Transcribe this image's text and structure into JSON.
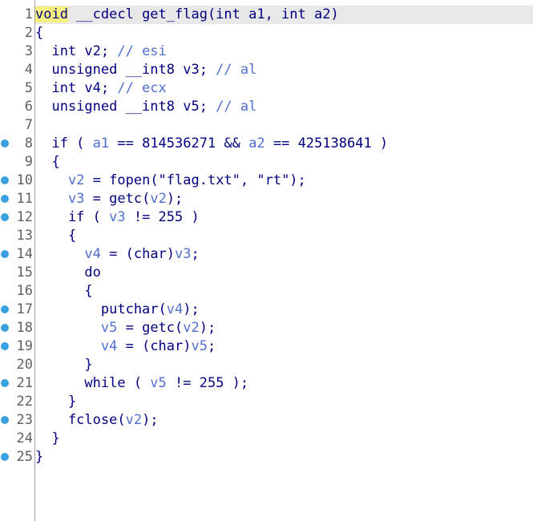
{
  "colors": {
    "background": "#ffffff",
    "keyword": "#000080",
    "variable": "#4f6fd0",
    "line_number": "#606060",
    "breakpoint": "#3aa0e0",
    "highlight_line": "#e8e8e8",
    "highlight_token": "#f5f080",
    "gutter_divider": "#a0a0a0"
  },
  "lines": [
    {
      "num": "1",
      "bp": false,
      "hl": true,
      "tokens": [
        {
          "t": "void",
          "c": "hl"
        },
        {
          "t": " __cdecl get_flag(int a1, int a2)",
          "c": "plain"
        }
      ]
    },
    {
      "num": "2",
      "bp": false,
      "tokens": [
        {
          "t": "{",
          "c": "plain"
        }
      ]
    },
    {
      "num": "3",
      "bp": false,
      "tokens": [
        {
          "t": "  int v2; // esi",
          "c": "mixcmt",
          "split": [
            "  int v2; ",
            "// esi"
          ]
        }
      ]
    },
    {
      "num": "4",
      "bp": false,
      "tokens": [
        {
          "t": "  unsigned __int8 v3; // al",
          "c": "mixcmt",
          "split": [
            "  unsigned __int8 v3; ",
            "// al"
          ]
        }
      ]
    },
    {
      "num": "5",
      "bp": false,
      "tokens": [
        {
          "t": "  int v4; // ecx",
          "c": "mixcmt",
          "split": [
            "  int v4; ",
            "// ecx"
          ]
        }
      ]
    },
    {
      "num": "6",
      "bp": false,
      "tokens": [
        {
          "t": "  unsigned __int8 v5; // al",
          "c": "mixcmt",
          "split": [
            "  unsigned __int8 v5; ",
            "// al"
          ]
        }
      ]
    },
    {
      "num": "7",
      "bp": false,
      "tokens": []
    },
    {
      "num": "8",
      "bp": true,
      "tokens": [
        {
          "t": "  if ( ",
          "c": "plain"
        },
        {
          "t": "a1",
          "c": "var"
        },
        {
          "t": " == 814536271 && ",
          "c": "plain"
        },
        {
          "t": "a2",
          "c": "var"
        },
        {
          "t": " == 425138641 )",
          "c": "plain"
        }
      ]
    },
    {
      "num": "9",
      "bp": false,
      "tokens": [
        {
          "t": "  {",
          "c": "plain"
        }
      ]
    },
    {
      "num": "10",
      "bp": true,
      "tokens": [
        {
          "t": "    ",
          "c": "plain"
        },
        {
          "t": "v2",
          "c": "var"
        },
        {
          "t": " = fopen(\"flag.txt\", \"rt\");",
          "c": "plain"
        }
      ]
    },
    {
      "num": "11",
      "bp": true,
      "tokens": [
        {
          "t": "    ",
          "c": "plain"
        },
        {
          "t": "v3",
          "c": "var"
        },
        {
          "t": " = getc(",
          "c": "plain"
        },
        {
          "t": "v2",
          "c": "var"
        },
        {
          "t": ");",
          "c": "plain"
        }
      ]
    },
    {
      "num": "12",
      "bp": true,
      "tokens": [
        {
          "t": "    if ( ",
          "c": "plain"
        },
        {
          "t": "v3",
          "c": "var"
        },
        {
          "t": " != 255 )",
          "c": "plain"
        }
      ]
    },
    {
      "num": "13",
      "bp": false,
      "tokens": [
        {
          "t": "    {",
          "c": "plain"
        }
      ]
    },
    {
      "num": "14",
      "bp": true,
      "tokens": [
        {
          "t": "      ",
          "c": "plain"
        },
        {
          "t": "v4",
          "c": "var"
        },
        {
          "t": " = (char)",
          "c": "plain"
        },
        {
          "t": "v3",
          "c": "var"
        },
        {
          "t": ";",
          "c": "plain"
        }
      ]
    },
    {
      "num": "15",
      "bp": false,
      "tokens": [
        {
          "t": "      do",
          "c": "plain"
        }
      ]
    },
    {
      "num": "16",
      "bp": false,
      "tokens": [
        {
          "t": "      {",
          "c": "plain"
        }
      ]
    },
    {
      "num": "17",
      "bp": true,
      "tokens": [
        {
          "t": "        putchar(",
          "c": "plain"
        },
        {
          "t": "v4",
          "c": "var"
        },
        {
          "t": ");",
          "c": "plain"
        }
      ]
    },
    {
      "num": "18",
      "bp": true,
      "tokens": [
        {
          "t": "        ",
          "c": "plain"
        },
        {
          "t": "v5",
          "c": "var"
        },
        {
          "t": " = getc(",
          "c": "plain"
        },
        {
          "t": "v2",
          "c": "var"
        },
        {
          "t": ");",
          "c": "plain"
        }
      ]
    },
    {
      "num": "19",
      "bp": true,
      "tokens": [
        {
          "t": "        ",
          "c": "plain"
        },
        {
          "t": "v4",
          "c": "var"
        },
        {
          "t": " = (char)",
          "c": "plain"
        },
        {
          "t": "v5",
          "c": "var"
        },
        {
          "t": ";",
          "c": "plain"
        }
      ]
    },
    {
      "num": "20",
      "bp": false,
      "tokens": [
        {
          "t": "      }",
          "c": "plain"
        }
      ]
    },
    {
      "num": "21",
      "bp": true,
      "tokens": [
        {
          "t": "      while ( ",
          "c": "plain"
        },
        {
          "t": "v5",
          "c": "var"
        },
        {
          "t": " != 255 );",
          "c": "plain"
        }
      ]
    },
    {
      "num": "22",
      "bp": false,
      "tokens": [
        {
          "t": "    }",
          "c": "plain"
        }
      ]
    },
    {
      "num": "23",
      "bp": true,
      "tokens": [
        {
          "t": "    fclose(",
          "c": "plain"
        },
        {
          "t": "v2",
          "c": "var"
        },
        {
          "t": ");",
          "c": "plain"
        }
      ]
    },
    {
      "num": "24",
      "bp": false,
      "tokens": [
        {
          "t": "  }",
          "c": "plain"
        }
      ]
    },
    {
      "num": "25",
      "bp": true,
      "tokens": [
        {
          "t": "}",
          "c": "plain"
        }
      ]
    }
  ]
}
